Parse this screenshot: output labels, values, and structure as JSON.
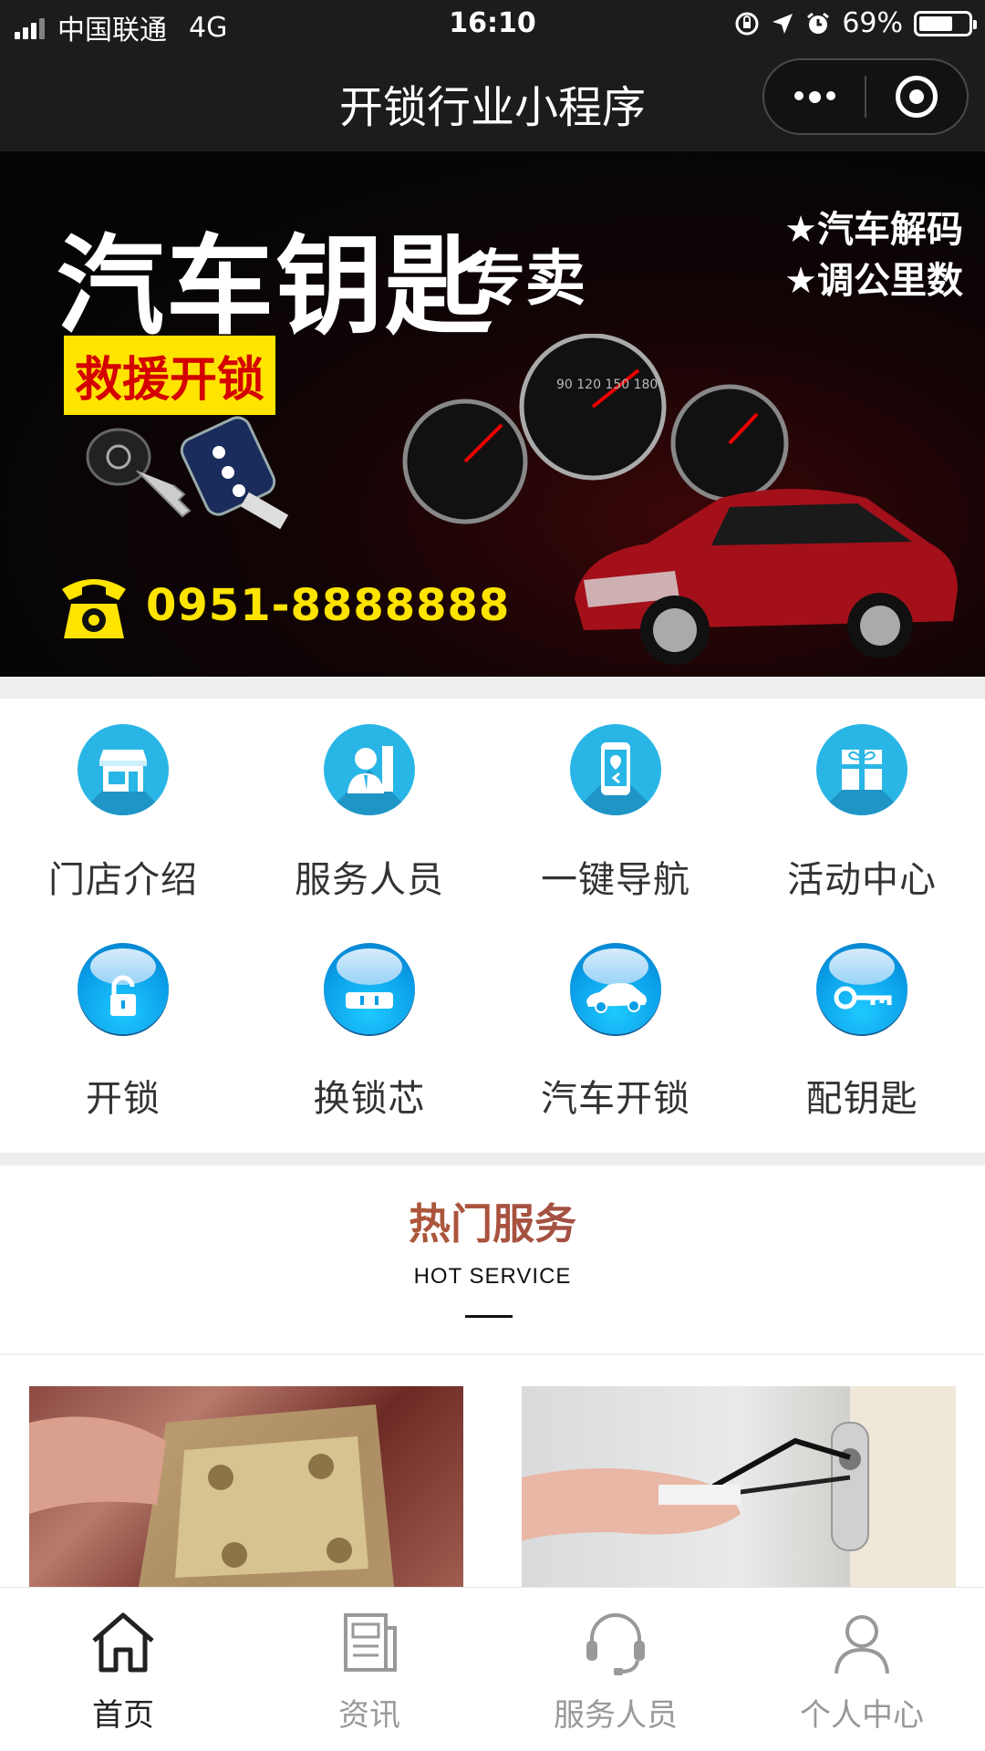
{
  "status_bar": {
    "carrier": "中国联通",
    "network": "4G",
    "time": "16:10",
    "battery": "69%",
    "battery_level": 0.69
  },
  "nav": {
    "title": "开锁行业小程序",
    "more_icon": "more-dots-icon",
    "close_icon": "target-circle-icon"
  },
  "banner": {
    "title": "汽车钥匙",
    "title_suffix": "专卖",
    "features": [
      "★汽车解码",
      "★调公里数"
    ],
    "rescue_tag": "救援开锁",
    "phone": "0951-8888888"
  },
  "grid": {
    "items": [
      {
        "label": "门店介绍",
        "icon": "storefront-icon"
      },
      {
        "label": "服务人员",
        "icon": "staff-person-icon"
      },
      {
        "label": "一键导航",
        "icon": "phone-navigation-icon"
      },
      {
        "label": "活动中心",
        "icon": "gift-icon"
      },
      {
        "label": "开锁",
        "icon": "padlock-icon"
      },
      {
        "label": "换锁芯",
        "icon": "lock-cylinder-icon"
      },
      {
        "label": "汽车开锁",
        "icon": "car-icon"
      },
      {
        "label": "配钥匙",
        "icon": "key-icon"
      }
    ]
  },
  "hot_service": {
    "title": "热门服务",
    "subtitle": "HOT SERVICE"
  },
  "tab_bar": {
    "tabs": [
      {
        "label": "首页",
        "icon": "home-icon",
        "active": true
      },
      {
        "label": "资讯",
        "icon": "news-icon",
        "active": false
      },
      {
        "label": "服务人员",
        "icon": "headset-icon",
        "active": false
      },
      {
        "label": "个人中心",
        "icon": "user-icon",
        "active": false
      }
    ]
  },
  "colors": {
    "bar_dark": "#1c1c1c",
    "icon_blue": "#29b6e6",
    "banner_yellow": "#ffe400",
    "rescue_red": "#d40000",
    "hot_title_orange": "#c26a1f"
  }
}
